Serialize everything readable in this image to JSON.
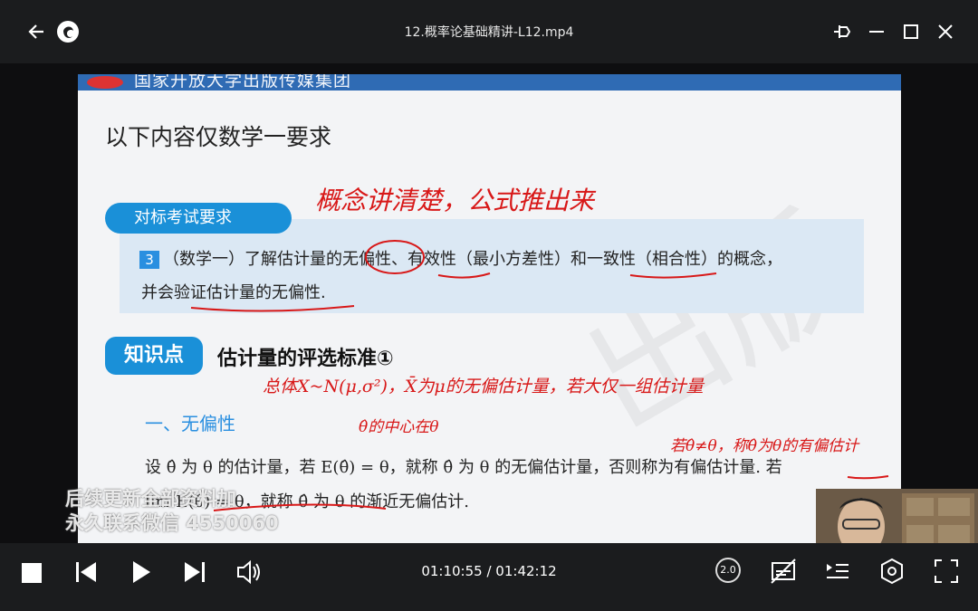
{
  "window": {
    "title": "12.概率论基础精讲-L12.mp4"
  },
  "slide": {
    "publisher": "国家开放大学出版传媒集团",
    "heading": "以下内容仅数学一要求",
    "requirement_badge": "对标考试要求",
    "requirement_number": "3",
    "requirement_line1": "（数学一）了解估计量的无偏性、有效性（最小方差性）和一致性（相合性）的概念，",
    "requirement_line2": "并会验证估计量的无偏性.",
    "knowledge_badge": "知识点",
    "knowledge_title": "估计量的评选标准①",
    "section_title": "一、无偏性",
    "body_line1": "设 θ̂ 为 θ 的估计量，若 E(θ̂) = θ，就称 θ̂ 为 θ 的无偏估计量，否则称为有偏估计量. 若",
    "body_line2": "lim E(θ̂) = θ，就称 θ̂ 为 θ 的渐近无偏估计."
  },
  "annotations": {
    "note1": "概念讲清楚，公式推出来",
    "note2": "总体X~N(μ,σ²)，X̄为μ的无偏估计量，若大仅一组估计量",
    "note3": "θ̂的中心在θ",
    "note4": "若θ̂≠θ，称θ̂为θ的有偏估计"
  },
  "watermark": {
    "line1": "后续更新全部资料加",
    "line2": "永久联系微信 4550060"
  },
  "player": {
    "current_time": "01:10:55",
    "separator": " / ",
    "total_time": "01:42:12",
    "progress_fraction": 0.694,
    "speed_label": "2.0",
    "accent_color": "#2a8fe0"
  },
  "icons": [
    "back-arrow-icon",
    "app-logo-icon",
    "pin-icon",
    "minimize-icon",
    "maximize-icon",
    "close-icon",
    "stop-icon",
    "previous-icon",
    "play-icon",
    "next-icon",
    "volume-icon",
    "speed-icon",
    "subtitle-icon",
    "playlist-icon",
    "settings-icon",
    "fullscreen-icon"
  ]
}
